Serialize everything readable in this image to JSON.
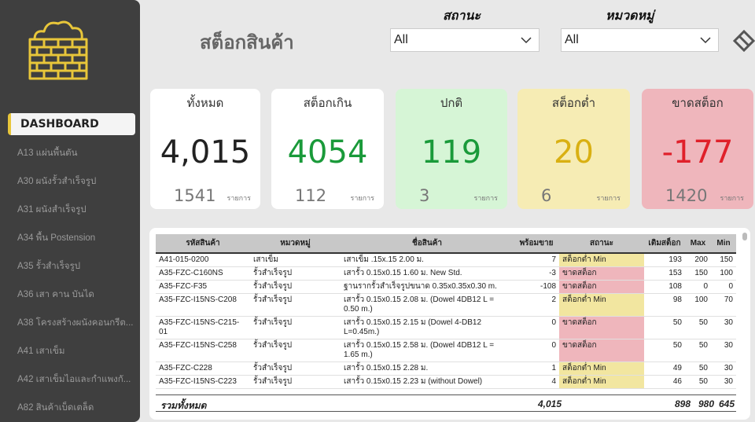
{
  "page": {
    "title": "สต็อกสินค้า"
  },
  "filters": [
    {
      "label": "สถานะ",
      "value": "All"
    },
    {
      "label": "หมวดหมู่",
      "value": "All"
    }
  ],
  "sidebar": {
    "dashboard_label": "DASHBOARD",
    "items": [
      "A13 แผ่นพื้นตัน",
      "A30 ผนังรั้วสำเร็จรูป",
      "A31 ผนังสำเร็จรูป",
      "A34 พื้น Postension",
      "A35 รั้วสำเร็จรูป",
      "A36 เสา คาน บันได",
      "A38 โครงสร้างผนังคอนกรีต...",
      "A41 เสาเข็ม",
      "A42 เสาเข็มไอและกำแพงกั...",
      "A82 สินค้าเบ็ดเตล็ด"
    ]
  },
  "kpis": [
    {
      "label": "ทั้งหมด",
      "value": "4,015",
      "count": "1541",
      "unit": "รายการ",
      "bg": "#ffffff",
      "color": "#222222"
    },
    {
      "label": "สต็อกเกิน",
      "value": "4054",
      "count": "112",
      "unit": "รายการ",
      "bg": "#ffffff",
      "color": "#1a9a3a"
    },
    {
      "label": "ปกติ",
      "value": "119",
      "count": "3",
      "unit": "รายการ",
      "bg": "#d6f5d6",
      "color": "#1a9a3a"
    },
    {
      "label": "สต็อกต่ำ",
      "value": "20",
      "count": "6",
      "unit": "รายการ",
      "bg": "#f6ecb4",
      "color": "#d9b012"
    },
    {
      "label": "ขาดสต็อก",
      "value": "-177",
      "count": "1420",
      "unit": "รายการ",
      "bg": "#efb6bc",
      "color": "#e0202a"
    }
  ],
  "table": {
    "columns": [
      "รหัสสินค้า",
      "หมวดหมู่",
      "ชื่อสินค้า",
      "พร้อมขาย",
      "สถานะ",
      "เติมสต็อก",
      "Max",
      "Min"
    ],
    "rows": [
      [
        "A41-015-0200",
        "เสาเข็ม",
        "เสาเข็ม .15x.15 2.00 ม.",
        "7",
        "สต็อกต่ำ Min",
        "193",
        "200",
        "150"
      ],
      [
        "A35-FZC-C160NS",
        "รั้วสำเร็จรูป",
        "เสารั้ว 0.15x0.15 1.60 ม. New Std.",
        "-3",
        "ขาดสต็อก",
        "153",
        "150",
        "100"
      ],
      [
        "A35-FZC-F35",
        "รั้วสำเร็จรูป",
        "ฐานรากรั้วสำเร็จรูปขนาด 0.35x0.35x0.30 m.",
        "-108",
        "ขาดสต็อก",
        "108",
        "0",
        "0"
      ],
      [
        "A35-FZC-I15NS-C208",
        "รั้วสำเร็จรูป",
        "เสารั้ว 0.15x0.15 2.08 ม. (Dowel 4DB12 L = 0.50 m.)",
        "2",
        "สต็อกต่ำ Min",
        "98",
        "100",
        "70"
      ],
      [
        "A35-FZC-I15NS-C215-01",
        "รั้วสำเร็จรูป",
        "เสารั้ว 0.15x0.15 2.15 ม (Dowel 4-DB12 L=0.45m.)",
        "0",
        "ขาดสต็อก",
        "50",
        "50",
        "30"
      ],
      [
        "A35-FZC-I15NS-C258",
        "รั้วสำเร็จรูป",
        "เสารั้ว 0.15x0.15 2.58 ม. (Dowel 4DB12 L = 1.65 m.)",
        "0",
        "ขาดสต็อก",
        "50",
        "50",
        "30"
      ],
      [
        "A35-FZC-C228",
        "รั้วสำเร็จรูป",
        "เสารั้ว 0.15x0.15 2.28 ม.",
        "1",
        "สต็อกต่ำ Min",
        "49",
        "50",
        "30"
      ],
      [
        "A35-FZC-I15NS-C223",
        "รั้วสำเร็จรูป",
        "เสารั้ว 0.15x0.15 2.23 ม (without Dowel)",
        "4",
        "สต็อกต่ำ Min",
        "46",
        "50",
        "30"
      ]
    ],
    "totals": {
      "label": "รวมทั้งหมด",
      "available": "4,015",
      "refill": "898",
      "max": "980",
      "min": "645"
    }
  },
  "colors": {
    "sidebar": "#3f3f3f",
    "accent": "#e8c63a",
    "low": "#f2e6a0",
    "out": "#efb6bc"
  }
}
